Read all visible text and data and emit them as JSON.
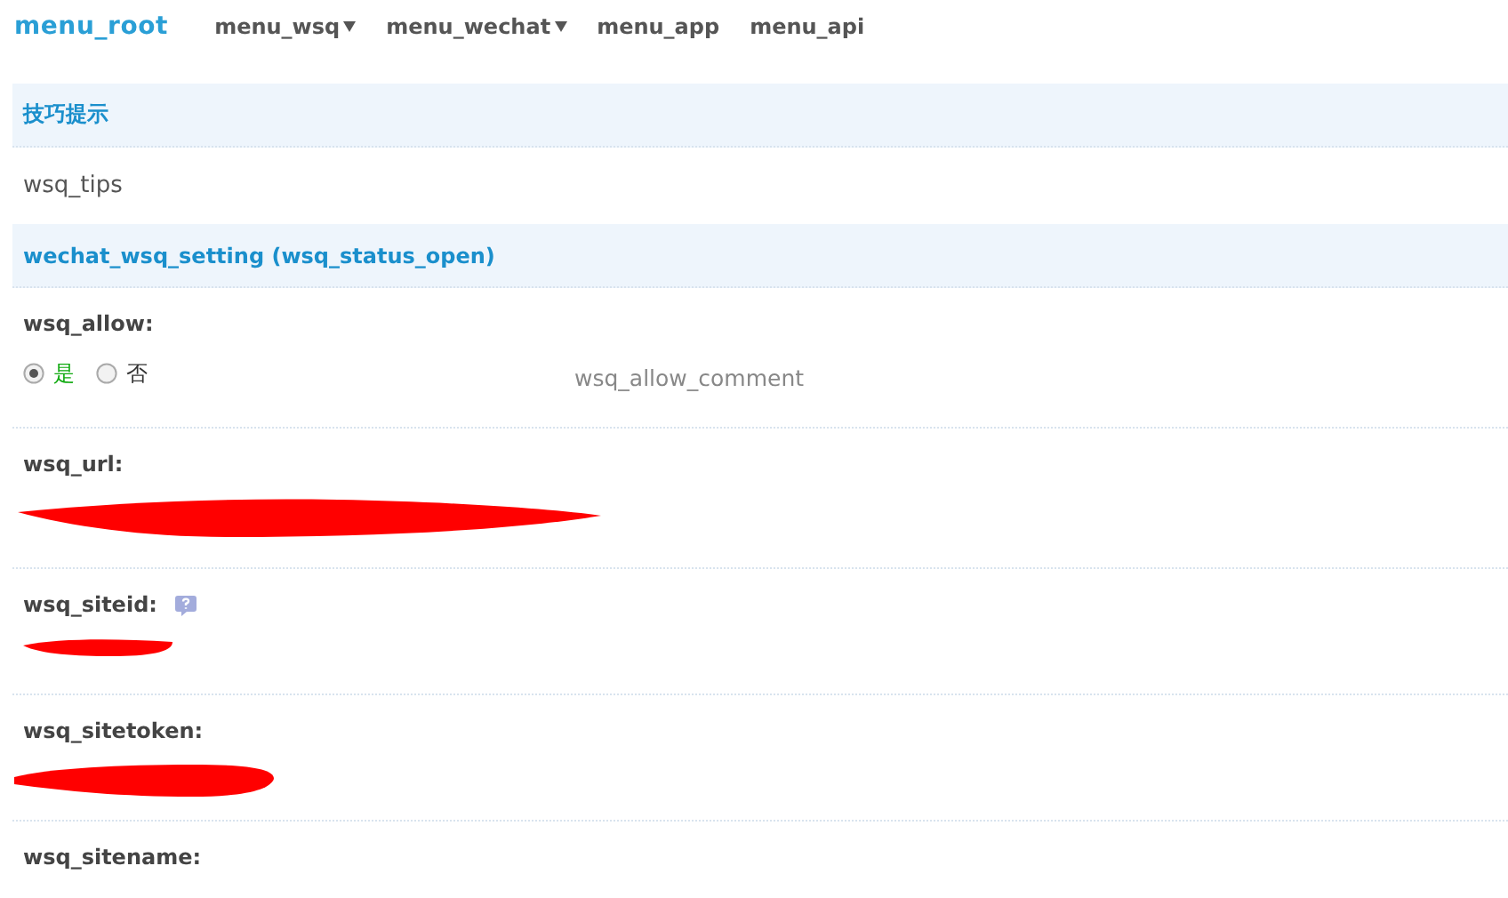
{
  "nav": {
    "root": "menu_root",
    "items": [
      {
        "label": "menu_wsq",
        "dropdown": true
      },
      {
        "label": "menu_wechat",
        "dropdown": true
      },
      {
        "label": "menu_app",
        "dropdown": false
      },
      {
        "label": "menu_api",
        "dropdown": false
      }
    ]
  },
  "tips": {
    "title": "技巧提示",
    "text": "wsq_tips"
  },
  "settings": {
    "title": "wechat_wsq_setting (wsq_status_open)",
    "fields": [
      {
        "kind": "radio",
        "label": "wsq_allow:",
        "help": false,
        "options": [
          {
            "label": "是",
            "selected": true
          },
          {
            "label": "否",
            "selected": false
          }
        ],
        "comment": "wsq_allow_comment"
      },
      {
        "kind": "redacted",
        "label": "wsq_url:",
        "help": false
      },
      {
        "kind": "redacted",
        "label": "wsq_siteid:",
        "help": true
      },
      {
        "kind": "redacted",
        "label": "wsq_sitetoken:",
        "help": false
      },
      {
        "kind": "empty",
        "label": "wsq_sitename:",
        "help": false
      }
    ]
  }
}
